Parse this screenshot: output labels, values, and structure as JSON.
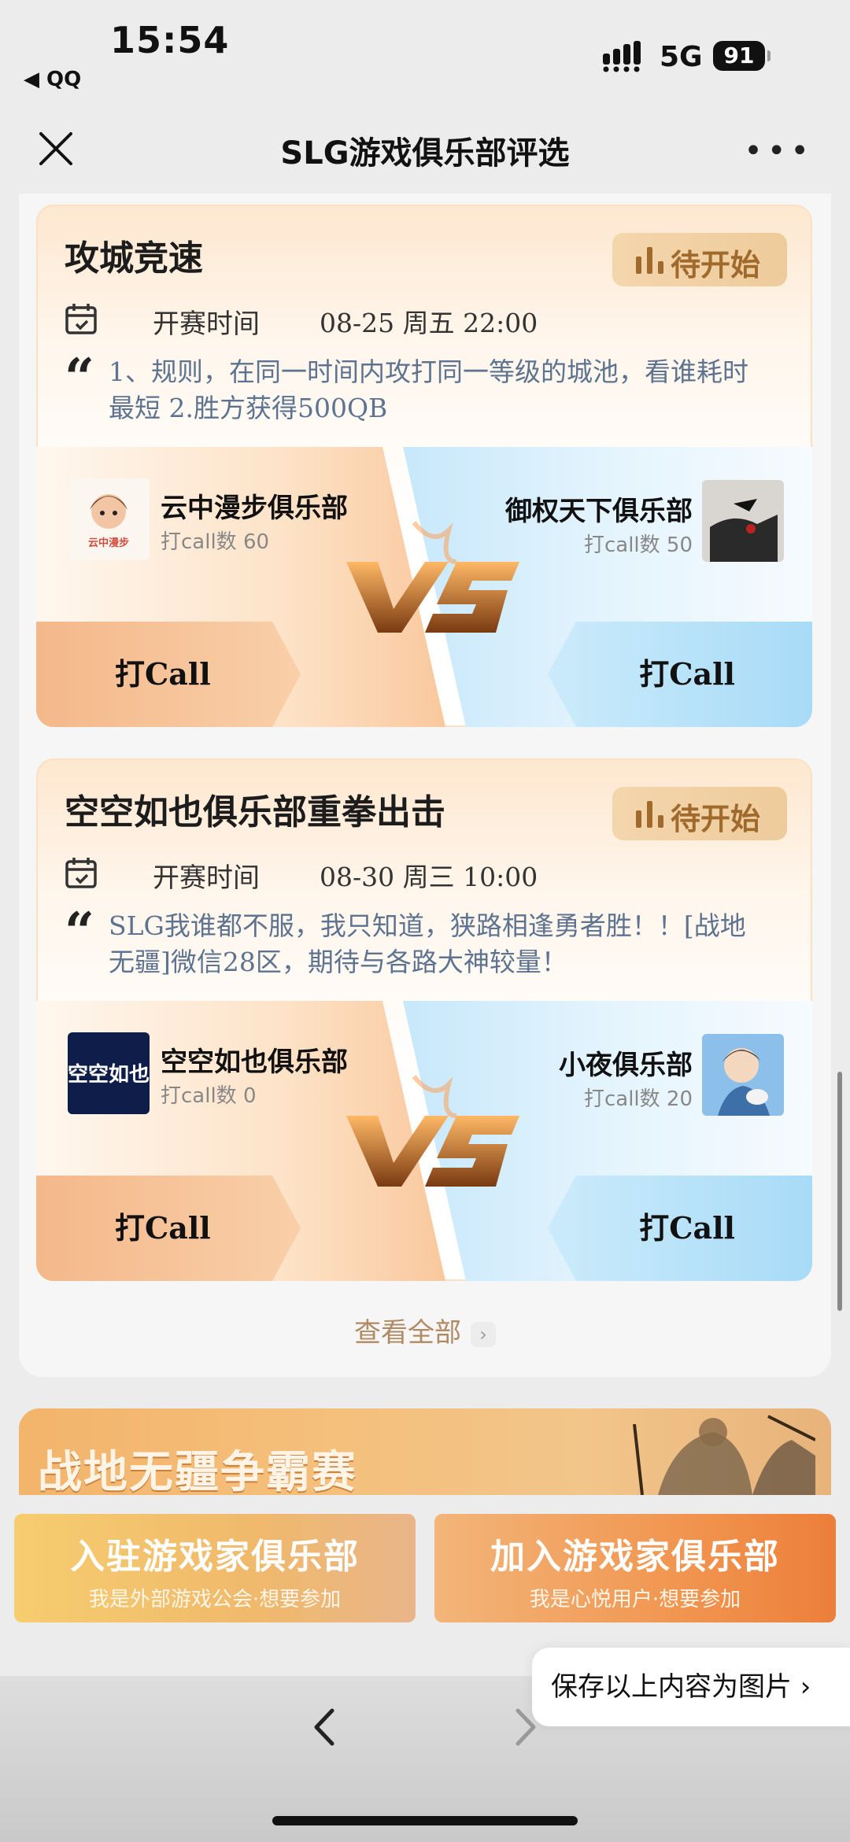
{
  "status_bar": {
    "time": "15:54",
    "back_app": "◀ QQ",
    "network": "5G",
    "battery": "91"
  },
  "nav": {
    "title": "SLG游戏俱乐部评选"
  },
  "matches": [
    {
      "title": "攻城竞速",
      "status": "待开始",
      "time_label": "开赛时间",
      "time_value": "08-25 周五 22:00",
      "description": "1、规则，在同一时间内攻打同一等级的城池，看谁耗时最短 2.胜方获得500QB",
      "left_club": {
        "name": "云中漫步俱乐部",
        "count": "打call数 60",
        "button": "打Call"
      },
      "right_club": {
        "name": "御权天下俱乐部",
        "count": "打call数 50",
        "button": "打Call"
      }
    },
    {
      "title": "空空如也俱乐部重拳出击",
      "status": "待开始",
      "time_label": "开赛时间",
      "time_value": "08-30 周三 10:00",
      "description": "SLG我谁都不服，我只知道，狭路相逢勇者胜！！[战地无疆]微信28区，期待与各路大神较量！",
      "left_club": {
        "name": "空空如也俱乐部",
        "count": "打call数 0",
        "button": "打Call"
      },
      "right_club": {
        "name": "小夜俱乐部",
        "count": "打call数 20",
        "button": "打Call"
      }
    }
  ],
  "view_all": "查看全部",
  "banner": {
    "title": "战地无疆争霸赛"
  },
  "join_buttons": [
    {
      "main": "入驻游戏家俱乐部",
      "sub": "我是外部游戏公会·想要参加"
    },
    {
      "main": "加入游戏家俱乐部",
      "sub": "我是心悦用户·想要参加"
    }
  ],
  "save_popup": "保存以上内容为图片 ›",
  "logo_texts": [
    "云中漫步",
    "空空如也"
  ],
  "colors": {
    "accent_orange": "#f19651",
    "status_text": "#a06a2c",
    "desc_text": "#5e7390",
    "view_all": "#b08a63"
  }
}
